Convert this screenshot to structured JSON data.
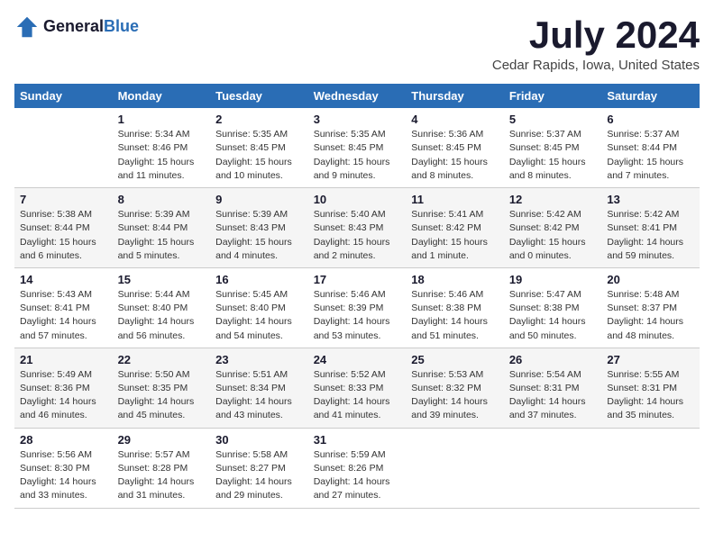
{
  "header": {
    "logo_general": "General",
    "logo_blue": "Blue",
    "month_year": "July 2024",
    "location": "Cedar Rapids, Iowa, United States"
  },
  "days_of_week": [
    "Sunday",
    "Monday",
    "Tuesday",
    "Wednesday",
    "Thursday",
    "Friday",
    "Saturday"
  ],
  "weeks": [
    [
      {
        "day": "",
        "info": ""
      },
      {
        "day": "1",
        "info": "Sunrise: 5:34 AM\nSunset: 8:46 PM\nDaylight: 15 hours\nand 11 minutes."
      },
      {
        "day": "2",
        "info": "Sunrise: 5:35 AM\nSunset: 8:45 PM\nDaylight: 15 hours\nand 10 minutes."
      },
      {
        "day": "3",
        "info": "Sunrise: 5:35 AM\nSunset: 8:45 PM\nDaylight: 15 hours\nand 9 minutes."
      },
      {
        "day": "4",
        "info": "Sunrise: 5:36 AM\nSunset: 8:45 PM\nDaylight: 15 hours\nand 8 minutes."
      },
      {
        "day": "5",
        "info": "Sunrise: 5:37 AM\nSunset: 8:45 PM\nDaylight: 15 hours\nand 8 minutes."
      },
      {
        "day": "6",
        "info": "Sunrise: 5:37 AM\nSunset: 8:44 PM\nDaylight: 15 hours\nand 7 minutes."
      }
    ],
    [
      {
        "day": "7",
        "info": "Sunrise: 5:38 AM\nSunset: 8:44 PM\nDaylight: 15 hours\nand 6 minutes."
      },
      {
        "day": "8",
        "info": "Sunrise: 5:39 AM\nSunset: 8:44 PM\nDaylight: 15 hours\nand 5 minutes."
      },
      {
        "day": "9",
        "info": "Sunrise: 5:39 AM\nSunset: 8:43 PM\nDaylight: 15 hours\nand 4 minutes."
      },
      {
        "day": "10",
        "info": "Sunrise: 5:40 AM\nSunset: 8:43 PM\nDaylight: 15 hours\nand 2 minutes."
      },
      {
        "day": "11",
        "info": "Sunrise: 5:41 AM\nSunset: 8:42 PM\nDaylight: 15 hours\nand 1 minute."
      },
      {
        "day": "12",
        "info": "Sunrise: 5:42 AM\nSunset: 8:42 PM\nDaylight: 15 hours\nand 0 minutes."
      },
      {
        "day": "13",
        "info": "Sunrise: 5:42 AM\nSunset: 8:41 PM\nDaylight: 14 hours\nand 59 minutes."
      }
    ],
    [
      {
        "day": "14",
        "info": "Sunrise: 5:43 AM\nSunset: 8:41 PM\nDaylight: 14 hours\nand 57 minutes."
      },
      {
        "day": "15",
        "info": "Sunrise: 5:44 AM\nSunset: 8:40 PM\nDaylight: 14 hours\nand 56 minutes."
      },
      {
        "day": "16",
        "info": "Sunrise: 5:45 AM\nSunset: 8:40 PM\nDaylight: 14 hours\nand 54 minutes."
      },
      {
        "day": "17",
        "info": "Sunrise: 5:46 AM\nSunset: 8:39 PM\nDaylight: 14 hours\nand 53 minutes."
      },
      {
        "day": "18",
        "info": "Sunrise: 5:46 AM\nSunset: 8:38 PM\nDaylight: 14 hours\nand 51 minutes."
      },
      {
        "day": "19",
        "info": "Sunrise: 5:47 AM\nSunset: 8:38 PM\nDaylight: 14 hours\nand 50 minutes."
      },
      {
        "day": "20",
        "info": "Sunrise: 5:48 AM\nSunset: 8:37 PM\nDaylight: 14 hours\nand 48 minutes."
      }
    ],
    [
      {
        "day": "21",
        "info": "Sunrise: 5:49 AM\nSunset: 8:36 PM\nDaylight: 14 hours\nand 46 minutes."
      },
      {
        "day": "22",
        "info": "Sunrise: 5:50 AM\nSunset: 8:35 PM\nDaylight: 14 hours\nand 45 minutes."
      },
      {
        "day": "23",
        "info": "Sunrise: 5:51 AM\nSunset: 8:34 PM\nDaylight: 14 hours\nand 43 minutes."
      },
      {
        "day": "24",
        "info": "Sunrise: 5:52 AM\nSunset: 8:33 PM\nDaylight: 14 hours\nand 41 minutes."
      },
      {
        "day": "25",
        "info": "Sunrise: 5:53 AM\nSunset: 8:32 PM\nDaylight: 14 hours\nand 39 minutes."
      },
      {
        "day": "26",
        "info": "Sunrise: 5:54 AM\nSunset: 8:31 PM\nDaylight: 14 hours\nand 37 minutes."
      },
      {
        "day": "27",
        "info": "Sunrise: 5:55 AM\nSunset: 8:31 PM\nDaylight: 14 hours\nand 35 minutes."
      }
    ],
    [
      {
        "day": "28",
        "info": "Sunrise: 5:56 AM\nSunset: 8:30 PM\nDaylight: 14 hours\nand 33 minutes."
      },
      {
        "day": "29",
        "info": "Sunrise: 5:57 AM\nSunset: 8:28 PM\nDaylight: 14 hours\nand 31 minutes."
      },
      {
        "day": "30",
        "info": "Sunrise: 5:58 AM\nSunset: 8:27 PM\nDaylight: 14 hours\nand 29 minutes."
      },
      {
        "day": "31",
        "info": "Sunrise: 5:59 AM\nSunset: 8:26 PM\nDaylight: 14 hours\nand 27 minutes."
      },
      {
        "day": "",
        "info": ""
      },
      {
        "day": "",
        "info": ""
      },
      {
        "day": "",
        "info": ""
      }
    ]
  ]
}
